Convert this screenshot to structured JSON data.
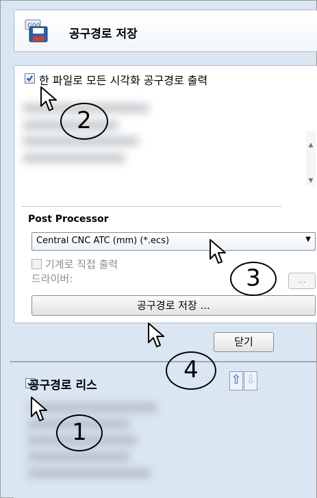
{
  "header": {
    "title": "공구경로 저장",
    "icon": "gcode-save-icon"
  },
  "export": {
    "checkbox_label": "한 파일로 모든 시각화 공구경로 출력",
    "checked": true
  },
  "post_processor": {
    "label": "Post Processor",
    "selected": "Central CNC ATC (mm) (*.ecs)"
  },
  "machine": {
    "direct_output_label": "기계로 직접 출력",
    "driver_label": "드라이버:",
    "browse_label": "..."
  },
  "buttons": {
    "save_label": "공구경로 저장 ...",
    "close_label": "닫기"
  },
  "toolpath_list": {
    "title": "공구경로 리스",
    "checked": true,
    "up_arrow": "⇧",
    "down_arrow": "⇩"
  },
  "annotations": {
    "step1": "1",
    "step2": "2",
    "step3": "3",
    "step4": "4"
  },
  "colors": {
    "panel_bg": "#dbe6f3",
    "border": "#a9b8cc",
    "accent": "#1f4b9c"
  }
}
